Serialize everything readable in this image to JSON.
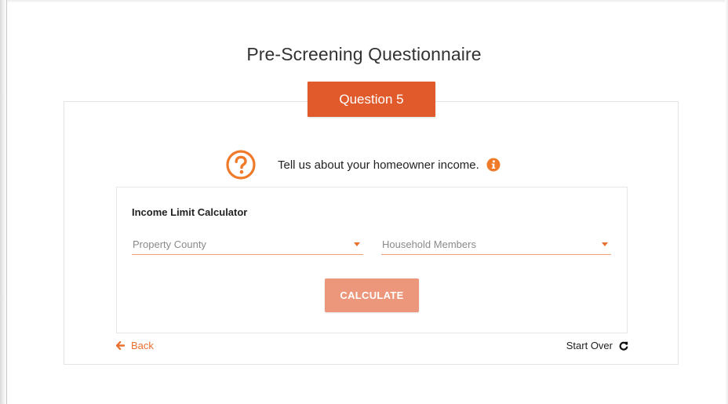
{
  "header": {
    "title": "Pre-Screening Questionnaire"
  },
  "question": {
    "tab_label": "Question 5",
    "prompt": "Tell us about your homeowner income.",
    "prompt_icon": "question-circle-icon",
    "info_icon": "info-circle-icon"
  },
  "calculator": {
    "title": "Income Limit Calculator",
    "county_select": {
      "placeholder": "Property County",
      "value": ""
    },
    "household_select": {
      "placeholder": "Household Members",
      "value": ""
    },
    "calculate_label": "CALCULATE"
  },
  "footer": {
    "back_label": "Back",
    "back_icon": "arrow-left-icon",
    "start_over_label": "Start Over",
    "start_over_icon": "redo-icon"
  },
  "colors": {
    "accent": "#e05a2b",
    "link": "#e8702f",
    "button_disabled": "#ec967b"
  }
}
